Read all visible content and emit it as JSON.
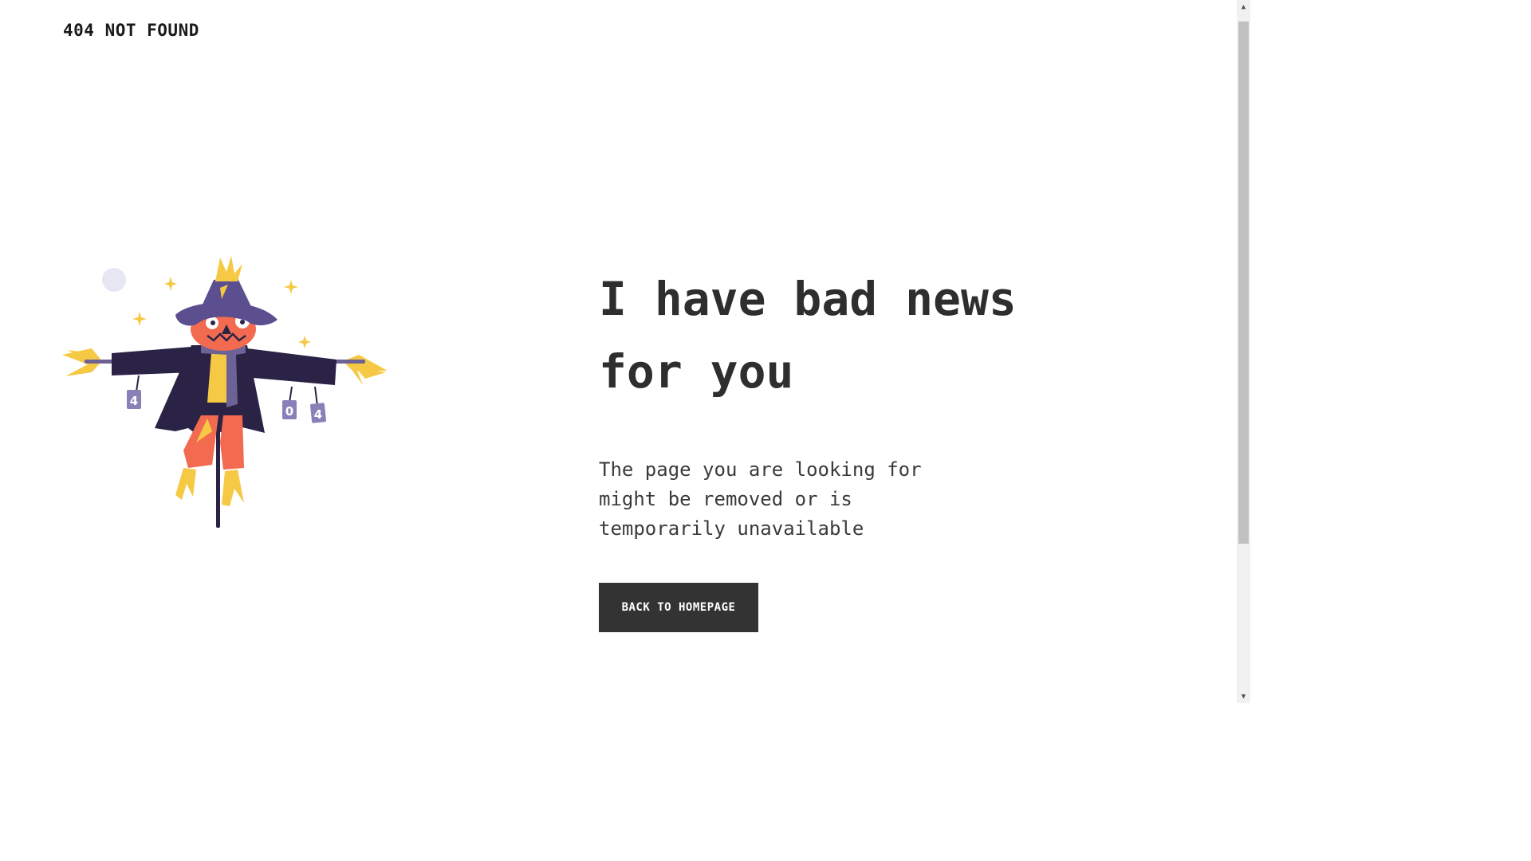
{
  "header": {
    "brand": "404 NOT FOUND"
  },
  "main": {
    "headline": "I have bad news for you",
    "message": "The page you are looking for might be removed or is temporarily unavailable",
    "button_label": "BACK TO HOMEPAGE"
  },
  "illustration": {
    "subject": "scarecrow-illustration",
    "can_labels": [
      "4",
      "0",
      "4"
    ],
    "colors": {
      "hat": "#5b4f8f",
      "coat": "#2a2346",
      "face": "#f26a4f",
      "straw": "#f6c945",
      "scarf": "#6d6296",
      "moon": "#e7e7f3"
    }
  },
  "scrollbar": {
    "up_icon": "arrow-up-icon",
    "down_icon": "arrow-down-icon"
  },
  "colors": {
    "background": "#ffffff",
    "text": "#333333",
    "button_bg": "#333333",
    "button_text": "#ffffff"
  }
}
